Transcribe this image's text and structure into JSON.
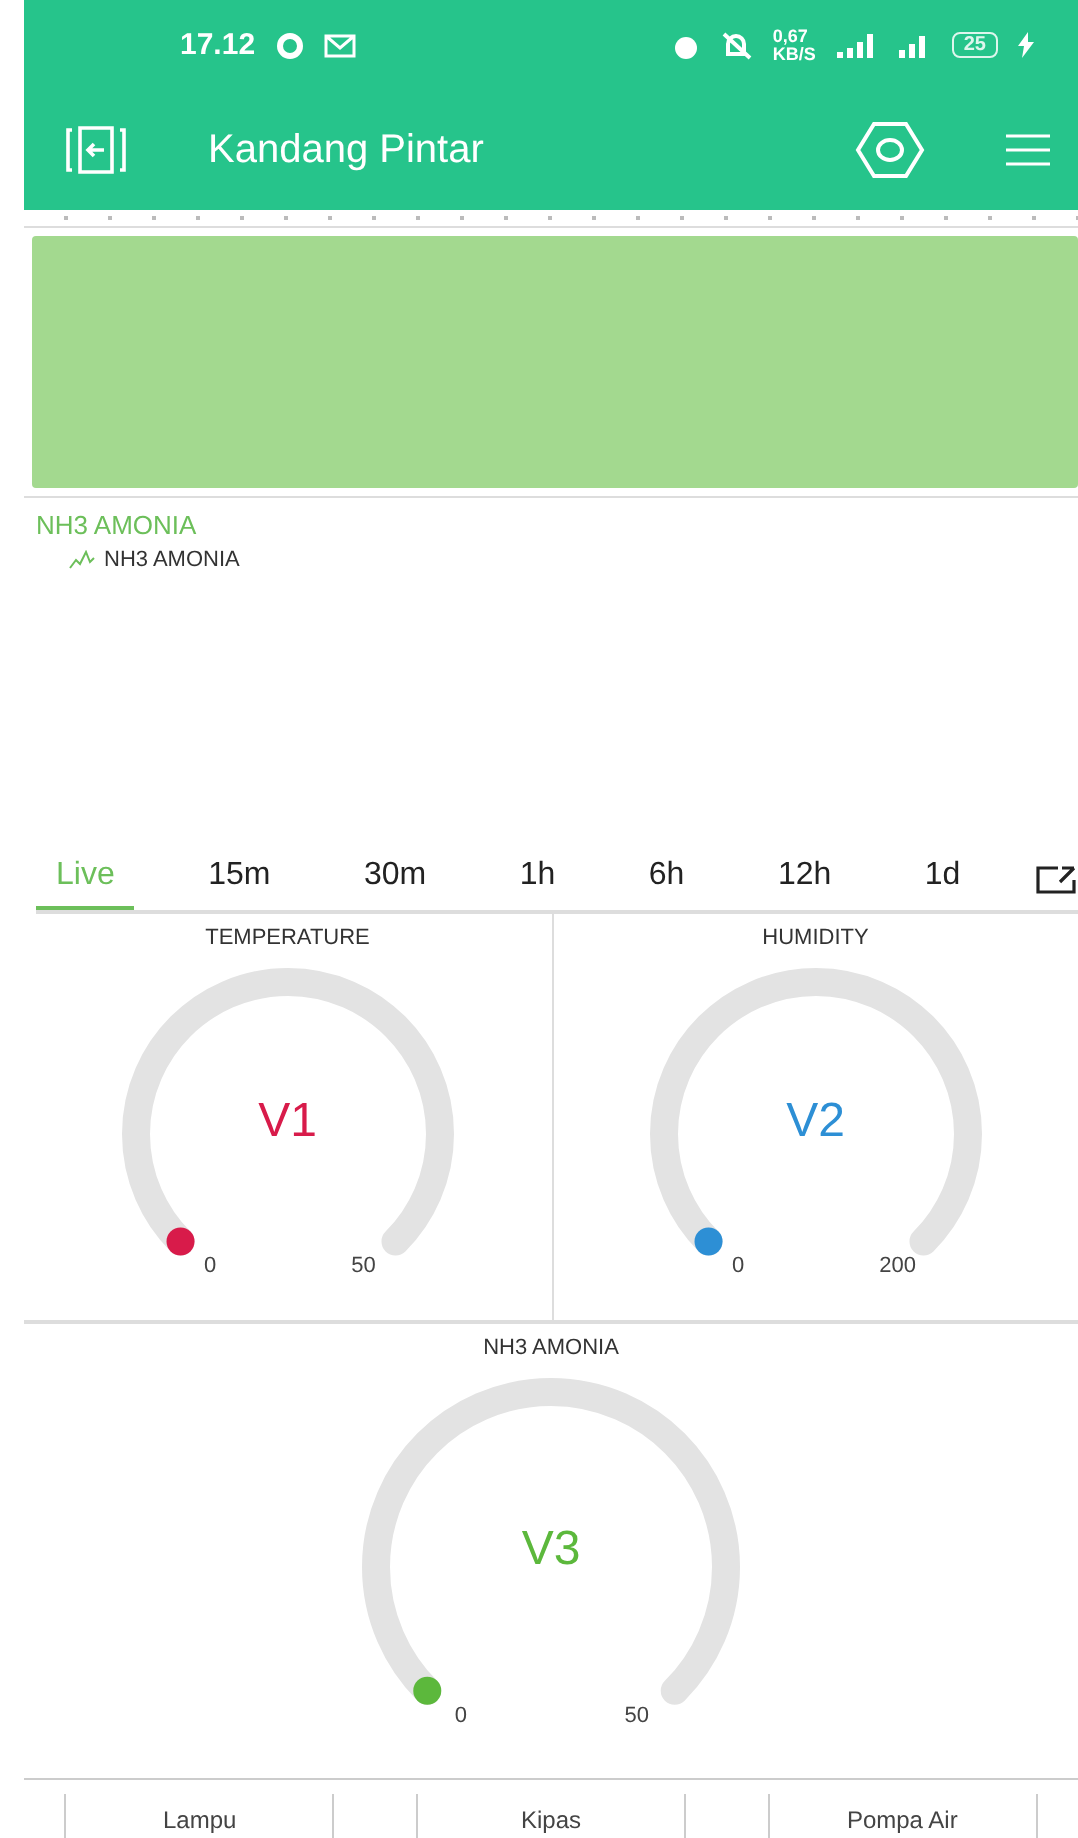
{
  "status_bar": {
    "time": "17.12",
    "speed": "0,67",
    "speed_unit": "KB/S",
    "battery": "25"
  },
  "app_bar": {
    "title": "Kandang Pintar"
  },
  "chart": {
    "title": "NH3 AMONIA",
    "legend": "NH3 AMONIA"
  },
  "ranges": [
    {
      "label": "Live",
      "selected": true
    },
    {
      "label": "15m",
      "selected": false
    },
    {
      "label": "30m",
      "selected": false
    },
    {
      "label": "1h",
      "selected": false
    },
    {
      "label": "6h",
      "selected": false
    },
    {
      "label": "12h",
      "selected": false
    },
    {
      "label": "1d",
      "selected": false
    }
  ],
  "gauges": [
    {
      "title": "TEMPERATURE",
      "value": "V1",
      "min": "0",
      "max": "50",
      "color": "#d81b4a"
    },
    {
      "title": "HUMIDITY",
      "value": "V2",
      "min": "0",
      "max": "200",
      "color": "#2d8fd5"
    },
    {
      "title": "NH3 AMONIA",
      "value": "V3",
      "min": "0",
      "max": "50",
      "color": "#5cb83c"
    }
  ],
  "buttons": [
    {
      "label": "Lampu"
    },
    {
      "label": "Kipas"
    },
    {
      "label": "Pompa Air"
    }
  ]
}
